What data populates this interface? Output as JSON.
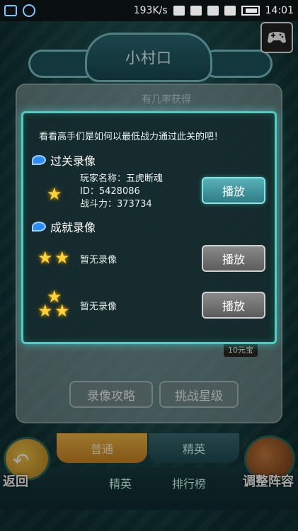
{
  "status_bar": {
    "speed": "193K/s",
    "time": "14:01"
  },
  "title": "小村口",
  "background": {
    "heading": "有几率获得",
    "price_tag": "10元宝",
    "buttons": {
      "video_guide": "录像攻略",
      "challenge_stars": "挑战星级"
    },
    "tabs": {
      "normal": "普通",
      "elite": "精英"
    },
    "bottom_nav": {
      "elite": "精英",
      "leaderboard": "排行榜"
    },
    "corner": {
      "back": "返回",
      "adjust_formation": "调整阵容"
    }
  },
  "dialog": {
    "intro": "看看高手们是如何以最低战力通过此关的吧！",
    "clear_section_title": "过关录像",
    "player": {
      "name_label": "玩家名称：",
      "name": "五虎断魂",
      "id_label": "ID：",
      "id": "5428086",
      "power_label": "战斗力：",
      "power": "373734"
    },
    "play_label": "播放",
    "achievement_section_title": "成就录像",
    "no_record": "暂无录像",
    "achievement_records": [
      {
        "stars": 2,
        "status": "暂无录像"
      },
      {
        "stars": 3,
        "status": "暂无录像"
      }
    ],
    "clear_record": {
      "stars": 1
    }
  },
  "icons": {
    "gamepad": "gamepad-icon",
    "star": "star-icon",
    "swirl": "swirl-icon",
    "back": "return-arrow-icon"
  },
  "colors": {
    "dialog_border": "#47d1c5",
    "active_button": "#2f7c86",
    "disabled_button": "#5c5c5c",
    "star": "#ffd43a"
  }
}
